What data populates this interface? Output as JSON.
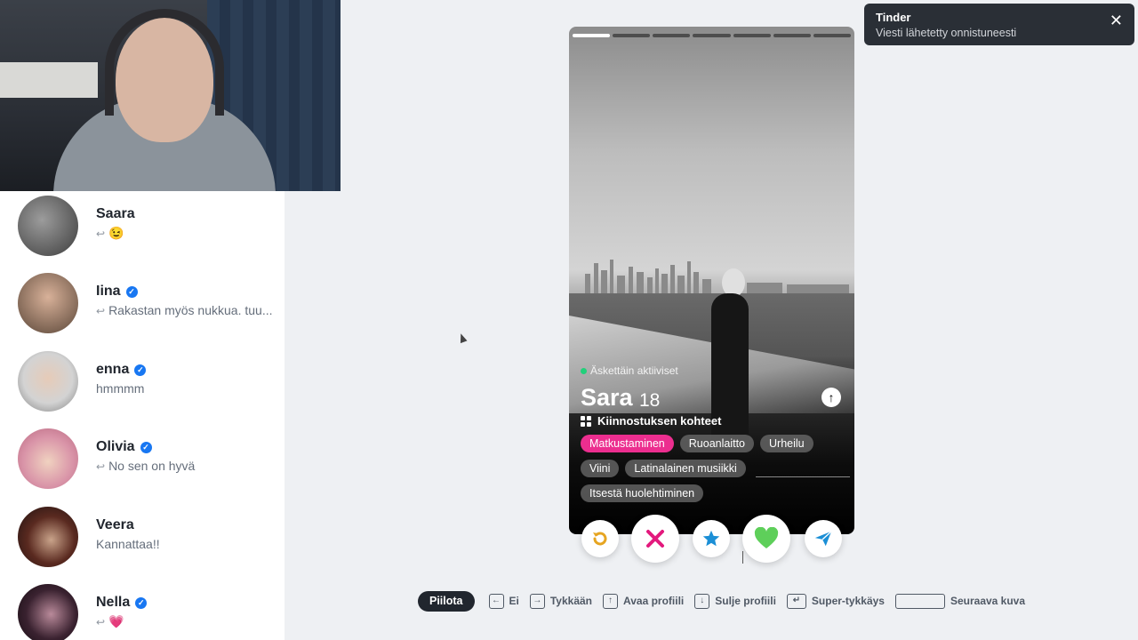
{
  "toast": {
    "title": "Tinder",
    "message": "Viesti lähetetty onnistuneesti",
    "close": "✕"
  },
  "matches": [
    {
      "name": "Saara",
      "verified": false,
      "reply": true,
      "message": "😉"
    },
    {
      "name": "Iina",
      "verified": true,
      "reply": true,
      "message": "Rakastan myös nukkua. tuu..."
    },
    {
      "name": "enna",
      "verified": true,
      "reply": false,
      "message": "hmmmm"
    },
    {
      "name": "Olivia",
      "verified": true,
      "reply": true,
      "message": "No sen on hyvä"
    },
    {
      "name": "Veera",
      "verified": false,
      "reply": false,
      "message": "Kannattaa!!"
    },
    {
      "name": "Nella",
      "verified": true,
      "reply": true,
      "message": "💗"
    }
  ],
  "profile": {
    "status": "Äskettäin aktiiviset",
    "name": "Sara",
    "age": "18",
    "interests_title": "Kiinnostuksen kohteet",
    "interests": [
      "Matkustaminen",
      "Ruoanlaitto",
      "Urheilu",
      "Viini",
      "Latinalainen musiikki",
      "Itsestä huolehtiminen"
    ],
    "highlighted_interest": "Matkustaminen",
    "photo_count": 7,
    "current_photo": 1
  },
  "actions": {
    "rewind": "rewind-icon",
    "nope": "x-icon",
    "super_like": "star-icon",
    "like": "heart-icon",
    "boost": "send-icon"
  },
  "hints": {
    "hide": "Piilota",
    "nope": "Ei",
    "like": "Tykkään",
    "open_profile": "Avaa profiili",
    "close_profile": "Sulje profiili",
    "super_like": "Super-tykkäys",
    "next_photo": "Seuraava kuva"
  },
  "colors": {
    "accent_pink": "#ec2e8f",
    "like_green": "#5ecf5a",
    "nope_red": "#e3197d",
    "super_blue": "#1b8fd6",
    "rewind_gold": "#e6a521",
    "verified_blue": "#1877f2",
    "online_green": "#21d07a"
  }
}
